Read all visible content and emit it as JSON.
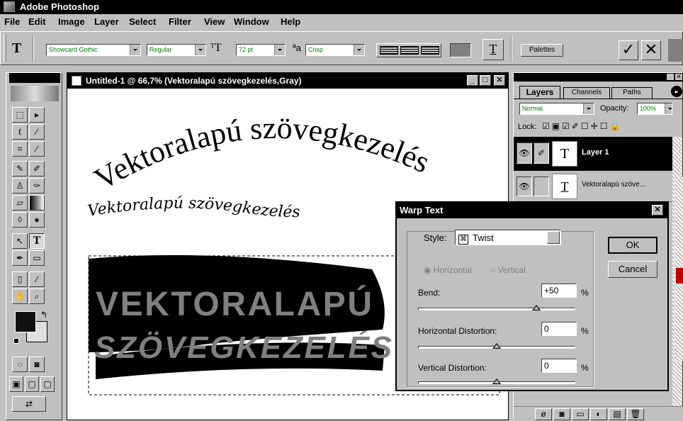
{
  "app": {
    "title": "Adobe Photoshop"
  },
  "menu": [
    "File",
    "Edit",
    "Image",
    "Layer",
    "Select",
    "Filter",
    "View",
    "Window",
    "Help"
  ],
  "options": {
    "font_family": "Showcard Gothic",
    "font_style": "Regular",
    "font_size": "72 pt",
    "antialias": "Crisp",
    "palettes_label": "Palettes"
  },
  "document": {
    "title": "Untitled-1 @ 66,7% (Vektoralapú szövegkezelés,Gray)",
    "arc_text": "Vektoralapú szövegkezelés",
    "script_text": "Vektoralapú szövegkezelés",
    "warp_line1": "VEKTORALAPÚ",
    "warp_line2": "SZÖVEGKEZELÉS"
  },
  "layers_panel": {
    "tabs": [
      "Layers",
      "Channels",
      "Paths"
    ],
    "blend_mode": "Normal",
    "opacity_label": "Opacity:",
    "opacity_value": "100%",
    "lock_label": "Lock:",
    "layer1_name": "Layer 1",
    "layer2_name": "Vektoralapú szöve..."
  },
  "warp_dialog": {
    "title": "Warp Text",
    "style_label": "Style:",
    "style_value": "Twist",
    "horizontal_label": "Horizontal",
    "vertical_label": "Vertical",
    "bend_label": "Bend:",
    "bend_value": "+50",
    "hdist_label": "Horizontal Distortion:",
    "hdist_value": "0",
    "vdist_label": "Vertical Distortion:",
    "vdist_value": "0",
    "percent": "%",
    "ok_label": "OK",
    "cancel_label": "Cancel",
    "bend_level": 75,
    "hdist_level": 50,
    "vdist_level": 50
  }
}
